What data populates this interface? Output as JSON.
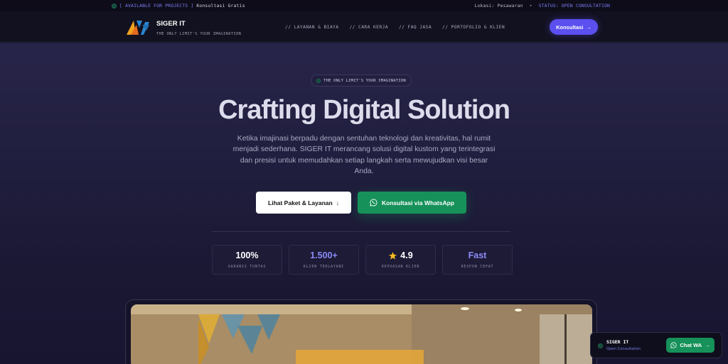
{
  "topbar": {
    "available": "[ AVAILABLE FOR PROJECTS ]",
    "free_consult": "Konsultasi Gratis",
    "location": "Lokasi: Pesawaran",
    "separator": "•",
    "status": "STATUS: OPEN CONSULTATION"
  },
  "nav": {
    "brand_name": "SIGER IT",
    "brand_tagline": "THE ONLY LIMIT'S YOUR IMAGINATION",
    "links": [
      "// LAYANAN & BIAYA",
      "// CARA KERJA",
      "// FAQ JASA",
      "// PORTOFOLIO & KLIEN"
    ],
    "cta_label": "Konsultasi",
    "cta_arrow": "→"
  },
  "hero": {
    "pill": "THE ONLY LIMIT'S YOUR IMAGINATION",
    "title": "Crafting Digital Solution",
    "description": "Ketika imajinasi berpadu dengan sentuhan teknologi dan kreativitas, hal rumit menjadi sederhana. SIGER IT merancang solusi digital kustom yang terintegrasi dan presisi untuk memudahkan setiap langkah serta mewujudkan visi besar Anda.",
    "btn_primary": "Lihat Paket & Layanan",
    "btn_primary_arrow": "↓",
    "btn_whatsapp": "Konsultasi via WhatsApp"
  },
  "stats": [
    {
      "value": "100%",
      "label": "GARANSI TUNTAS"
    },
    {
      "value": "1.500+",
      "label": "KLIEN TERLAYANI"
    },
    {
      "value": "4.9",
      "label": "KEPUASAN KLIEN"
    },
    {
      "value": "Fast",
      "label": "RESPON CEPAT"
    }
  ],
  "chat_widget": {
    "name": "SIGER IT",
    "status": "Open Consultation",
    "button": "Chat WA",
    "arrow": "→"
  },
  "colors": {
    "accent": "#5b4ff0",
    "indigo_text": "#7b7cf5",
    "whatsapp_green": "#16915a",
    "background": "#1a1833"
  },
  "icons": {
    "logo": "siger-logo-icon",
    "whatsapp": "whatsapp-icon",
    "star": "star-icon"
  }
}
